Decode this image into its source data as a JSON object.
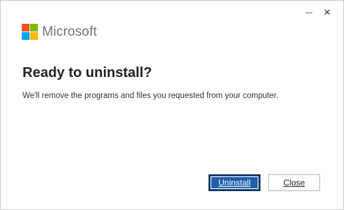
{
  "window": {
    "controls": {
      "minimize_glyph": "—",
      "close_glyph": "✕"
    }
  },
  "brand": {
    "name": "Microsoft",
    "logo_colors": {
      "red": "#f25022",
      "green": "#7fba00",
      "blue": "#00a4ef",
      "yellow": "#ffb900"
    }
  },
  "dialog": {
    "title": "Ready to uninstall?",
    "description": "We'll remove the programs and files you requested from your computer."
  },
  "buttons": {
    "uninstall": "Uninstall",
    "close": "Close"
  },
  "colors": {
    "primary_button": "#1e5fa8",
    "primary_button_border": "#0c2f57"
  }
}
